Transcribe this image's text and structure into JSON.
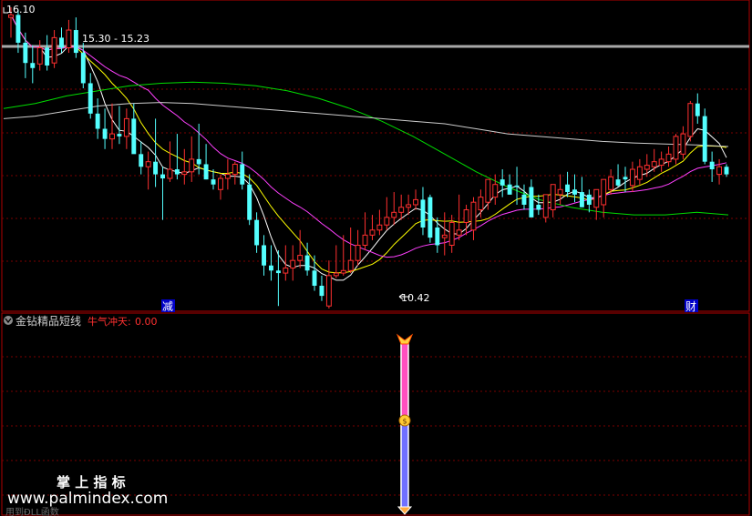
{
  "main_chart": {
    "high_label": "16.10",
    "low_label": "10.42",
    "range_label": "15.30 - 15.23",
    "signal_labels": [
      "减",
      "财"
    ],
    "colors": {
      "up": "#ff3030",
      "down": "#54ffff",
      "ma5": "#ffffff",
      "ma10": "#ffff00",
      "ma20": "#ff40ff",
      "ma60": "#00dd00",
      "ma120": "#cccccc",
      "level_line": "#a8a8a8",
      "grid": "#7a0000",
      "signal_bg": "#0000c8",
      "signal_text": "#ffffff"
    }
  },
  "indicator_panel": {
    "name": "金钻精品短线",
    "param_label": "牛气冲天:",
    "param_value": "0.00",
    "colors": {
      "name": "#d0d0d0",
      "param": "#ff3030",
      "bar_top": "#ff50c0",
      "bar_bottom": "#7070ff"
    }
  },
  "watermark": {
    "cn": "掌 上 指 标",
    "url": "www.palmindex.com",
    "sub": "用到ÐLL函数"
  },
  "chart_data": {
    "type": "candlestick",
    "ylim": [
      10.0,
      16.3
    ],
    "yticks": [
      10.42,
      15.23,
      15.3,
      16.1
    ],
    "grid": true,
    "x": [
      1,
      2,
      3,
      4,
      5,
      6,
      7,
      8,
      9,
      10,
      11,
      12,
      13,
      14,
      15,
      16,
      17,
      18,
      19,
      20,
      21,
      22,
      23,
      24,
      25,
      26,
      27,
      28,
      29,
      30,
      31,
      32,
      33,
      34,
      35,
      36,
      37,
      38,
      39,
      40,
      41,
      42,
      43,
      44,
      45,
      46,
      47,
      48,
      49,
      50,
      51,
      52,
      53,
      54,
      55,
      56,
      57,
      58,
      59,
      60,
      61,
      62,
      63,
      64,
      65,
      66,
      67,
      68,
      69,
      70,
      71,
      72,
      73,
      74,
      75,
      76,
      77,
      78,
      79,
      80,
      81,
      82,
      83,
      84,
      85,
      86,
      87,
      88,
      89,
      90,
      91,
      92,
      93,
      94,
      95,
      96,
      97,
      98,
      99,
      100
    ],
    "open": [
      15.9,
      15.95,
      15.4,
      15.0,
      14.98,
      15.3,
      15.0,
      15.5,
      15.3,
      15.65,
      15.2,
      14.6,
      14.0,
      13.7,
      13.5,
      13.6,
      13.55,
      13.9,
      13.2,
      12.95,
      13.05,
      12.8,
      12.72,
      12.9,
      12.8,
      12.85,
      13.1,
      13.0,
      12.7,
      12.5,
      12.72,
      12.8,
      13.0,
      12.6,
      11.9,
      11.4,
      11.0,
      10.9,
      10.85,
      10.95,
      11.1,
      11.2,
      10.9,
      10.6,
      10.2,
      10.8,
      10.85,
      10.9,
      11.1,
      11.4,
      11.6,
      11.7,
      11.8,
      11.95,
      12.05,
      12.15,
      12.2,
      12.3,
      12.35,
      11.75,
      11.55,
      11.4,
      11.6,
      11.85,
      11.7,
      12.1,
      12.25,
      12.35,
      12.7,
      12.6,
      12.58,
      12.4,
      12.55,
      12.2,
      11.95,
      12.1,
      12.4,
      12.6,
      12.5,
      12.45,
      12.4,
      12.15,
      12.2,
      12.5,
      12.7,
      12.75,
      12.58,
      12.7,
      12.9,
      12.95,
      12.98,
      13.05,
      13.1,
      13.2,
      13.55,
      14.2,
      13.95,
      13.05,
      12.8,
      12.95
    ],
    "high": [
      16.1,
      16.05,
      15.6,
      15.35,
      15.45,
      15.55,
      15.65,
      15.7,
      15.85,
      15.9,
      15.4,
      14.8,
      14.3,
      14.1,
      14.2,
      14.15,
      14.1,
      14.2,
      13.45,
      13.25,
      13.9,
      12.95,
      13.45,
      13.6,
      13.3,
      13.55,
      13.8,
      13.4,
      12.9,
      12.8,
      13.1,
      13.05,
      13.25,
      12.8,
      12.05,
      11.6,
      11.4,
      11.3,
      11.4,
      11.4,
      11.7,
      11.45,
      11.2,
      10.8,
      11.1,
      11.4,
      11.6,
      11.75,
      11.7,
      12.05,
      12.0,
      12.1,
      12.35,
      12.45,
      12.4,
      12.4,
      12.5,
      12.55,
      12.4,
      11.95,
      12.05,
      12.0,
      12.4,
      12.2,
      12.35,
      12.5,
      12.6,
      12.8,
      12.9,
      12.8,
      12.95,
      12.6,
      12.7,
      12.4,
      12.2,
      12.5,
      12.8,
      12.85,
      12.8,
      12.75,
      12.5,
      12.4,
      12.5,
      12.9,
      13.0,
      12.95,
      13.05,
      13.1,
      13.2,
      13.3,
      13.25,
      13.35,
      13.6,
      13.75,
      14.25,
      14.4,
      14.1,
      13.25,
      13.1,
      13.0
    ],
    "low": [
      15.5,
      15.2,
      14.7,
      14.6,
      14.85,
      14.85,
      14.9,
      15.2,
      15.2,
      15.1,
      14.5,
      13.9,
      13.5,
      13.3,
      13.3,
      13.4,
      13.3,
      13.5,
      12.8,
      12.5,
      12.55,
      11.9,
      12.65,
      12.7,
      12.6,
      12.65,
      12.8,
      12.7,
      12.5,
      12.3,
      12.5,
      12.6,
      12.5,
      11.8,
      11.25,
      10.8,
      10.7,
      10.2,
      10.7,
      10.7,
      10.95,
      10.8,
      10.5,
      10.3,
      10.15,
      10.75,
      10.8,
      10.85,
      11.0,
      11.3,
      11.5,
      11.6,
      11.7,
      11.8,
      11.9,
      12.0,
      12.1,
      11.6,
      11.45,
      11.25,
      11.2,
      11.25,
      11.5,
      11.6,
      11.5,
      11.95,
      12.1,
      12.2,
      12.35,
      12.4,
      12.2,
      12.1,
      12.15,
      12.0,
      11.85,
      11.95,
      12.2,
      12.35,
      12.25,
      12.15,
      12.05,
      11.9,
      11.95,
      12.4,
      12.55,
      12.45,
      12.45,
      12.6,
      12.75,
      12.85,
      12.85,
      12.95,
      13.0,
      13.1,
      13.45,
      13.8,
      13.0,
      12.65,
      12.6,
      12.75
    ],
    "close": [
      15.95,
      15.4,
      15.0,
      14.9,
      15.3,
      14.95,
      15.5,
      15.3,
      15.65,
      15.2,
      14.6,
      14.0,
      13.7,
      13.5,
      13.6,
      13.55,
      13.9,
      13.2,
      12.95,
      13.05,
      12.8,
      12.72,
      12.9,
      12.8,
      12.85,
      13.1,
      13.0,
      12.7,
      12.6,
      12.72,
      12.8,
      13.0,
      12.6,
      11.9,
      11.4,
      11.0,
      10.9,
      10.85,
      10.95,
      11.1,
      11.2,
      10.9,
      10.6,
      10.4,
      10.8,
      10.85,
      10.9,
      11.1,
      11.4,
      11.6,
      11.7,
      11.8,
      11.95,
      12.05,
      12.15,
      12.2,
      12.3,
      11.75,
      11.55,
      11.4,
      11.6,
      11.85,
      11.7,
      12.1,
      12.25,
      12.35,
      12.7,
      12.6,
      12.58,
      12.4,
      12.55,
      12.2,
      11.95,
      12.1,
      12.4,
      12.6,
      12.5,
      12.45,
      12.4,
      12.15,
      12.2,
      12.5,
      12.7,
      12.75,
      12.58,
      12.7,
      12.9,
      12.95,
      12.98,
      13.05,
      13.1,
      13.2,
      13.55,
      13.6,
      14.2,
      13.95,
      13.05,
      12.9,
      12.95,
      12.8
    ],
    "series": [
      {
        "name": "MA5",
        "smoothing": 5
      },
      {
        "name": "MA10",
        "smoothing": 10
      },
      {
        "name": "MA20",
        "smoothing": 20
      },
      {
        "name": "MA60",
        "values": [
          14.1,
          14.2,
          14.35,
          14.45,
          14.55,
          14.6,
          14.62,
          14.6,
          14.55,
          14.45,
          14.3,
          14.1,
          13.85,
          13.55,
          13.2,
          12.85,
          12.55,
          12.3,
          12.15,
          12.05,
          12.0,
          12.0,
          12.05,
          12.0
        ]
      },
      {
        "name": "MA120",
        "values": [
          13.9,
          13.95,
          14.05,
          14.15,
          14.2,
          14.22,
          14.2,
          14.15,
          14.1,
          14.05,
          14.0,
          13.95,
          13.9,
          13.85,
          13.8,
          13.7,
          13.6,
          13.55,
          13.5,
          13.45,
          13.42,
          13.4,
          13.38,
          13.35
        ]
      }
    ],
    "signals": [
      {
        "label": "减",
        "at": 45
      },
      {
        "label": "财",
        "at": 96
      }
    ]
  }
}
